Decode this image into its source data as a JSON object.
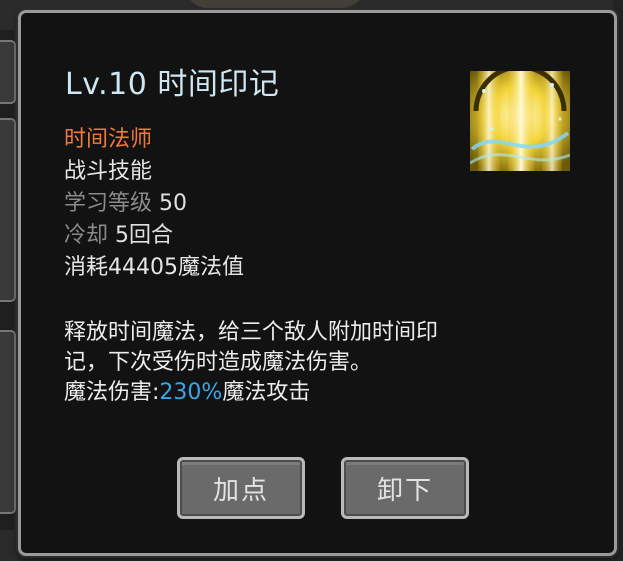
{
  "skill": {
    "title": "Lv.10 时间印记",
    "icon": "time-mark-skill-icon",
    "class_name": "时间法师",
    "skill_type": "战斗技能",
    "learn_level": {
      "label": "学习等级",
      "value": "50"
    },
    "cooldown": {
      "label": "冷却",
      "value": "5回合"
    },
    "cost": "消耗44405魔法值"
  },
  "description": {
    "line1": "释放时间魔法，给三个敌人附加时间印",
    "line2": "记，下次受伤时造成魔法伤害。",
    "damage_prefix": "魔法伤害:",
    "damage_percent": "230%",
    "damage_suffix": "魔法攻击"
  },
  "buttons": {
    "add_point": "加点",
    "unequip": "卸下"
  },
  "colors": {
    "title": "#cfe6f3",
    "class_name": "#f07a3e",
    "dim_label": "#8a8a8a",
    "percent": "#3aa6e8",
    "panel_bg": "#121212",
    "panel_border": "#9a9a9a",
    "button_bg": "#6a6a6a"
  }
}
